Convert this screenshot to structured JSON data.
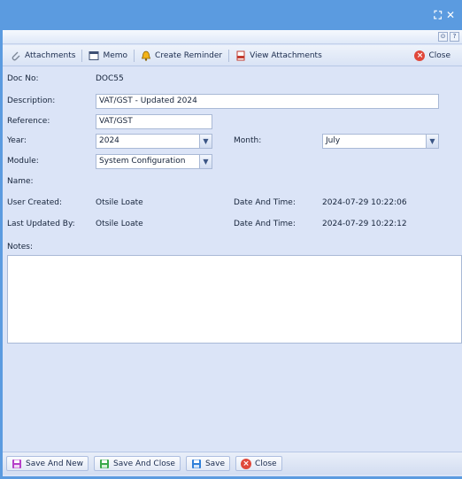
{
  "window": {
    "icons": {
      "maximize": "⛶",
      "close": "✕"
    }
  },
  "small_strip": {
    "btn1": "⊙",
    "btn2": "?"
  },
  "toolbar": {
    "attachments": "Attachments",
    "memo": "Memo",
    "create_reminder": "Create Reminder",
    "view_attachments": "View Attachments",
    "close": "Close"
  },
  "form": {
    "doc_no_label": "Doc No:",
    "doc_no_value": "DOC55",
    "description_label": "Description:",
    "description_value": "VAT/GST - Updated 2024",
    "reference_label": "Reference:",
    "reference_value": "VAT/GST",
    "year_label": "Year:",
    "year_value": "2024",
    "month_label": "Month:",
    "month_value": "July",
    "module_label": "Module:",
    "module_value": "System Configuration",
    "name_label": "Name:",
    "user_created_label": "User Created:",
    "user_created_value": "Otsile Loate",
    "created_dt_label": "Date And Time:",
    "created_dt_value": "2024-07-29 10:22:06",
    "last_updated_label": "Last Updated By:",
    "last_updated_value": "Otsile Loate",
    "updated_dt_label": "Date And Time:",
    "updated_dt_value": "2024-07-29 10:22:12",
    "notes_label": "Notes:",
    "notes_value": ""
  },
  "bottom": {
    "save_and_new": "Save And New",
    "save_and_close": "Save And Close",
    "save": "Save",
    "close": "Close"
  },
  "colors": {
    "titlebar": "#5b9be0",
    "panel": "#dbe4f7",
    "close_icon": "#e0483b"
  }
}
